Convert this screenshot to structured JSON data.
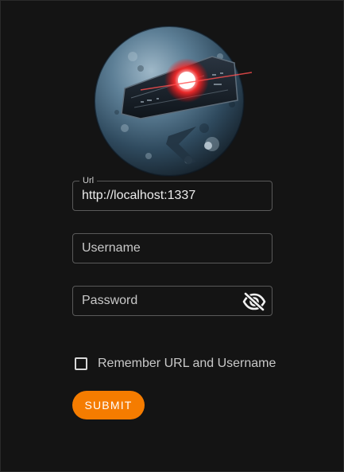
{
  "form": {
    "url": {
      "label": "Url",
      "value": "http://localhost:1337"
    },
    "username": {
      "placeholder": "Username",
      "value": ""
    },
    "password": {
      "placeholder": "Password",
      "value": ""
    },
    "remember": {
      "label": "Remember URL and Username",
      "checked": false
    },
    "submit_label": "SUBMIT"
  },
  "icons": {
    "logo": "planet-logo-icon",
    "password_toggle": "eye-off-icon",
    "checkbox": "checkbox-unchecked-icon"
  },
  "colors": {
    "background": "#141414",
    "accent": "#f57c00",
    "border": "#5a5a5a",
    "text": "#ececec"
  }
}
